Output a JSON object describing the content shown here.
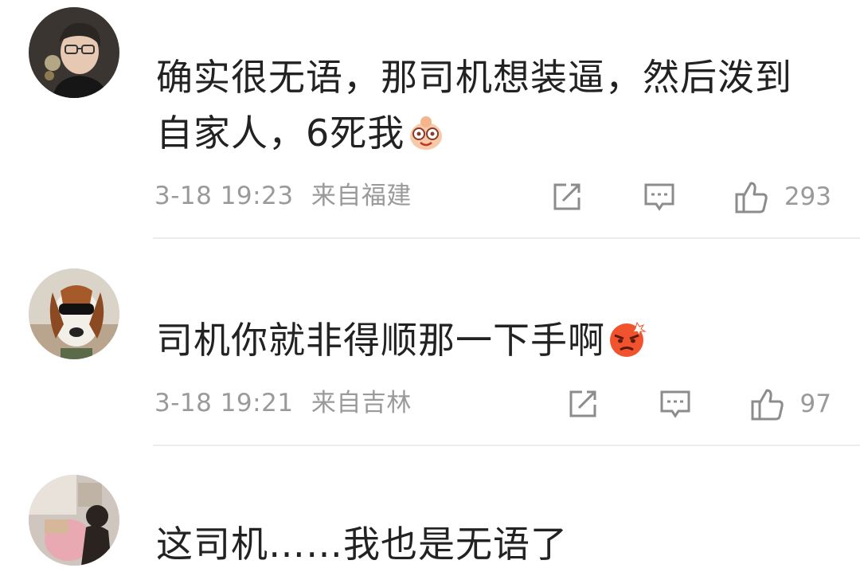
{
  "comments": [
    {
      "text": "确实很无语，那司机想装逼，然后泼到自家人，6死我",
      "emoji": "dizzy-smile-emoji",
      "time": "3-18 19:23",
      "location": "来自福建",
      "likes": "293"
    },
    {
      "text": "司机你就非得顺那一下手啊",
      "emoji": "angry-face-emoji",
      "time": "3-18 19:21",
      "location": "来自吉林",
      "likes": "97"
    },
    {
      "text": "这司机……我也是无语了"
    }
  ],
  "icons": {
    "share": "share-icon",
    "comment": "comment-icon",
    "like": "thumbs-up-icon"
  },
  "colors": {
    "text": "#222222",
    "meta": "#9a9a9a",
    "divider": "#ececec",
    "icon": "#8c8c8c"
  }
}
